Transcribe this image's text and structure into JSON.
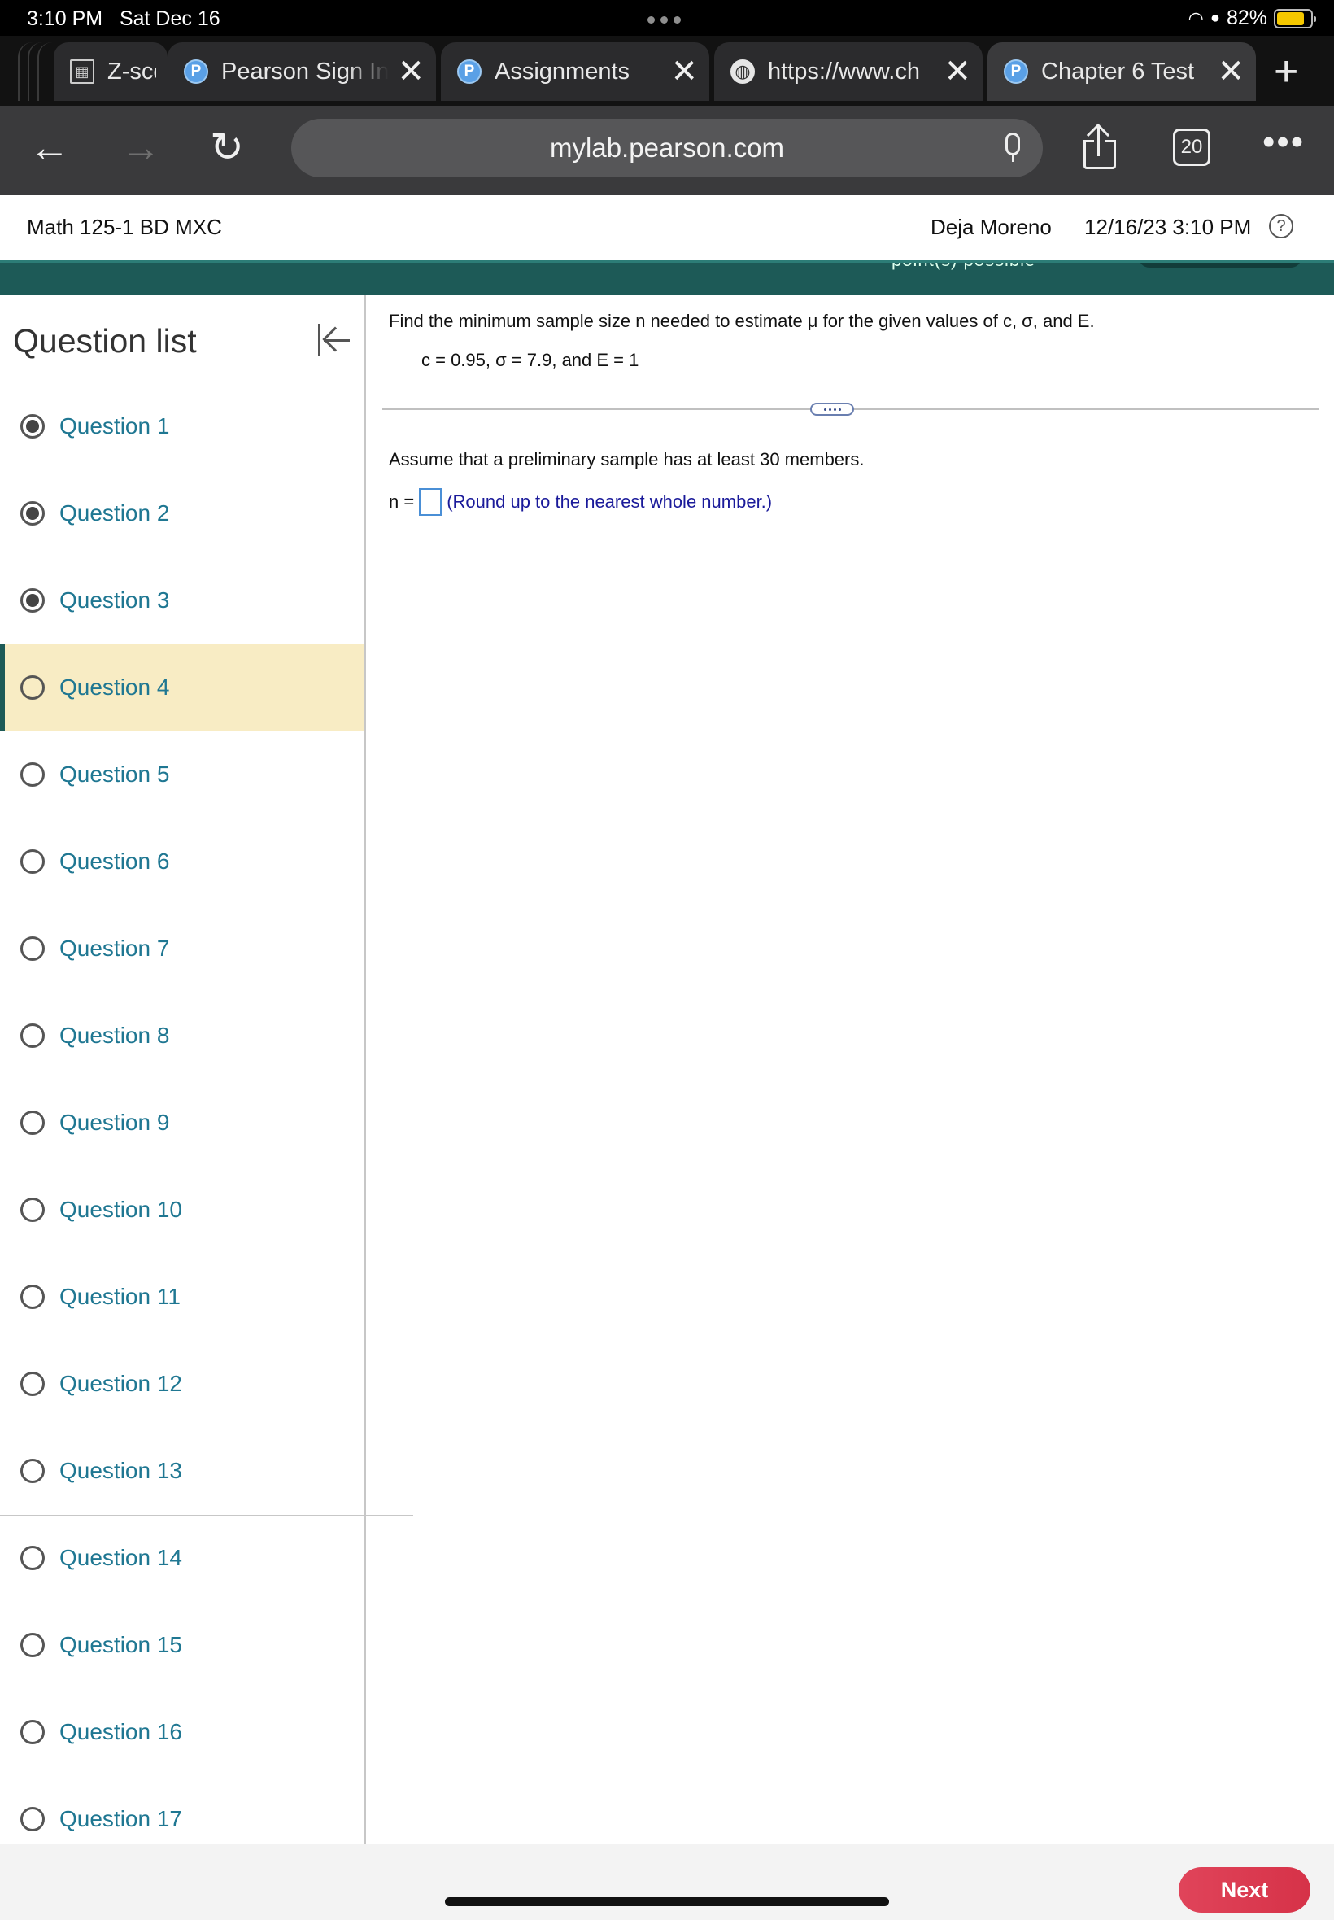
{
  "status_bar": {
    "time": "3:10 PM",
    "date": "Sat Dec 16",
    "battery": "82%",
    "battery_level": 0.82
  },
  "tabs": [
    {
      "title": "Z-sco",
      "icon": "spreadsheet-icon"
    },
    {
      "title": "Pearson Sign In",
      "icon": "pearson-icon"
    },
    {
      "title": "Assignments",
      "icon": "pearson-icon"
    },
    {
      "title": "https://www.ch",
      "icon": "globe-icon"
    },
    {
      "title": "Chapter 6 Test",
      "icon": "pearson-icon",
      "active": true
    }
  ],
  "tab_favicon_letter": "P",
  "address_bar": {
    "url": "mylab.pearson.com",
    "tab_count": "20"
  },
  "header": {
    "course": "Math 125-1 BD MXC",
    "user": "Deja Moreno",
    "datetime": "12/16/23 3:10 PM",
    "help": "?"
  },
  "clipped_text": "point(s) possible",
  "sidebar": {
    "title": "Question list",
    "items": [
      {
        "label": "Question 1",
        "done": true
      },
      {
        "label": "Question 2",
        "done": true
      },
      {
        "label": "Question 3",
        "done": true
      },
      {
        "label": "Question 4",
        "done": false,
        "current": true
      },
      {
        "label": "Question 5",
        "done": false
      },
      {
        "label": "Question 6",
        "done": false
      },
      {
        "label": "Question 7",
        "done": false
      },
      {
        "label": "Question 8",
        "done": false
      },
      {
        "label": "Question 9",
        "done": false
      },
      {
        "label": "Question 10",
        "done": false
      },
      {
        "label": "Question 11",
        "done": false
      },
      {
        "label": "Question 12",
        "done": false
      },
      {
        "label": "Question 13",
        "done": false
      },
      {
        "label": "Question 14",
        "done": false
      },
      {
        "label": "Question 15",
        "done": false
      },
      {
        "label": "Question 16",
        "done": false
      },
      {
        "label": "Question 17",
        "done": false
      }
    ]
  },
  "question": {
    "prompt": "Find the minimum sample size n needed to estimate μ for the given values of c, σ, and E.",
    "given": "c = 0.95, σ = 7.9, and E = 1",
    "assumption": "Assume that a preliminary sample has at least 30 members.",
    "answer_label": "n =",
    "answer_value": "",
    "hint": "(Round up to the nearest whole number.)"
  },
  "footer": {
    "next_label": "Next"
  },
  "colors": {
    "teal": "#1d5a57",
    "link": "#1f7792",
    "current_row": "#f8ecc4",
    "next_button": "#d63248"
  }
}
